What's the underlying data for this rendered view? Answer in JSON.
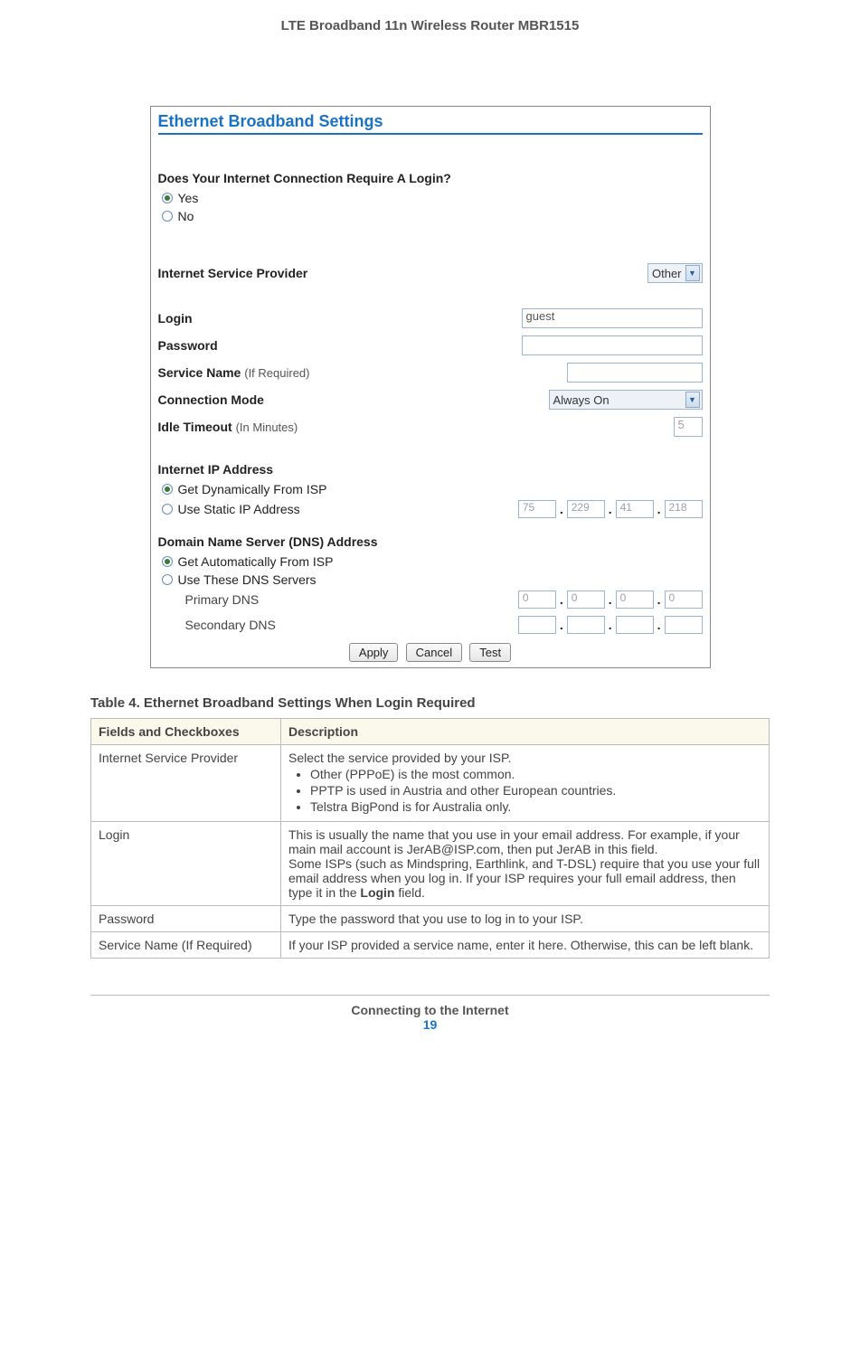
{
  "doc_header": "LTE Broadband 11n Wireless Router MBR1515",
  "panel": {
    "title": "Ethernet Broadband Settings",
    "q_login": "Does Your Internet Connection Require A Login?",
    "yes": "Yes",
    "no": "No",
    "isp_label": "Internet Service Provider",
    "isp_value": "Other",
    "login_label": "Login",
    "login_value": "guest",
    "password_label": "Password",
    "password_value": "",
    "service_label": "Service Name",
    "service_hint": "(If Required)",
    "service_value": "",
    "conn_mode_label": "Connection Mode",
    "conn_mode_value": "Always On",
    "idle_label": "Idle Timeout",
    "idle_hint": "(In Minutes)",
    "idle_value": "5",
    "ip_head": "Internet IP Address",
    "ip_dyn": "Get Dynamically From ISP",
    "ip_static": "Use Static IP Address",
    "ip_vals": [
      "75",
      "229",
      "41",
      "218"
    ],
    "dns_head": "Domain Name Server (DNS) Address",
    "dns_auto": "Get Automatically From ISP",
    "dns_use": "Use These DNS Servers",
    "dns_primary": "Primary DNS",
    "dns_secondary": "Secondary DNS",
    "dns_primary_vals": [
      "0",
      "0",
      "0",
      "0"
    ],
    "dns_secondary_vals": [
      "",
      "",
      "",
      ""
    ],
    "btn_apply": "Apply",
    "btn_cancel": "Cancel",
    "btn_test": "Test"
  },
  "table_caption": "Table 4.  Ethernet Broadband Settings When Login Required",
  "table_headers": [
    "Fields and Checkboxes",
    "Description"
  ],
  "rows": {
    "r0_f": "Internet Service Provider",
    "r0_d": "Select the service provided by your ISP.",
    "r0_li0": "Other (PPPoE) is the most common.",
    "r0_li1": "PPTP is used in Austria and other European countries.",
    "r0_li2": "Telstra BigPond is for Australia only.",
    "r1_f": "Login",
    "r1_d0": "This is usually the name that you use in your email address. For example, if your main mail account is JerAB@ISP.com, then put JerAB in this field.",
    "r1_d1a": "Some ISPs (such as Mindspring, Earthlink, and T-DSL) require that you use your full email address when you log in. If your ISP requires your full email address, then type it in the ",
    "r1_d1b": "Login",
    "r1_d1c": " field.",
    "r2_f": "Password",
    "r2_d": "Type the password that you use to log in to your ISP.",
    "r3_f": "Service Name (If Required)",
    "r3_d": "If your ISP provided a service name, enter it here. Otherwise, this can be left blank."
  },
  "footer_title": "Connecting to the Internet",
  "footer_num": "19"
}
